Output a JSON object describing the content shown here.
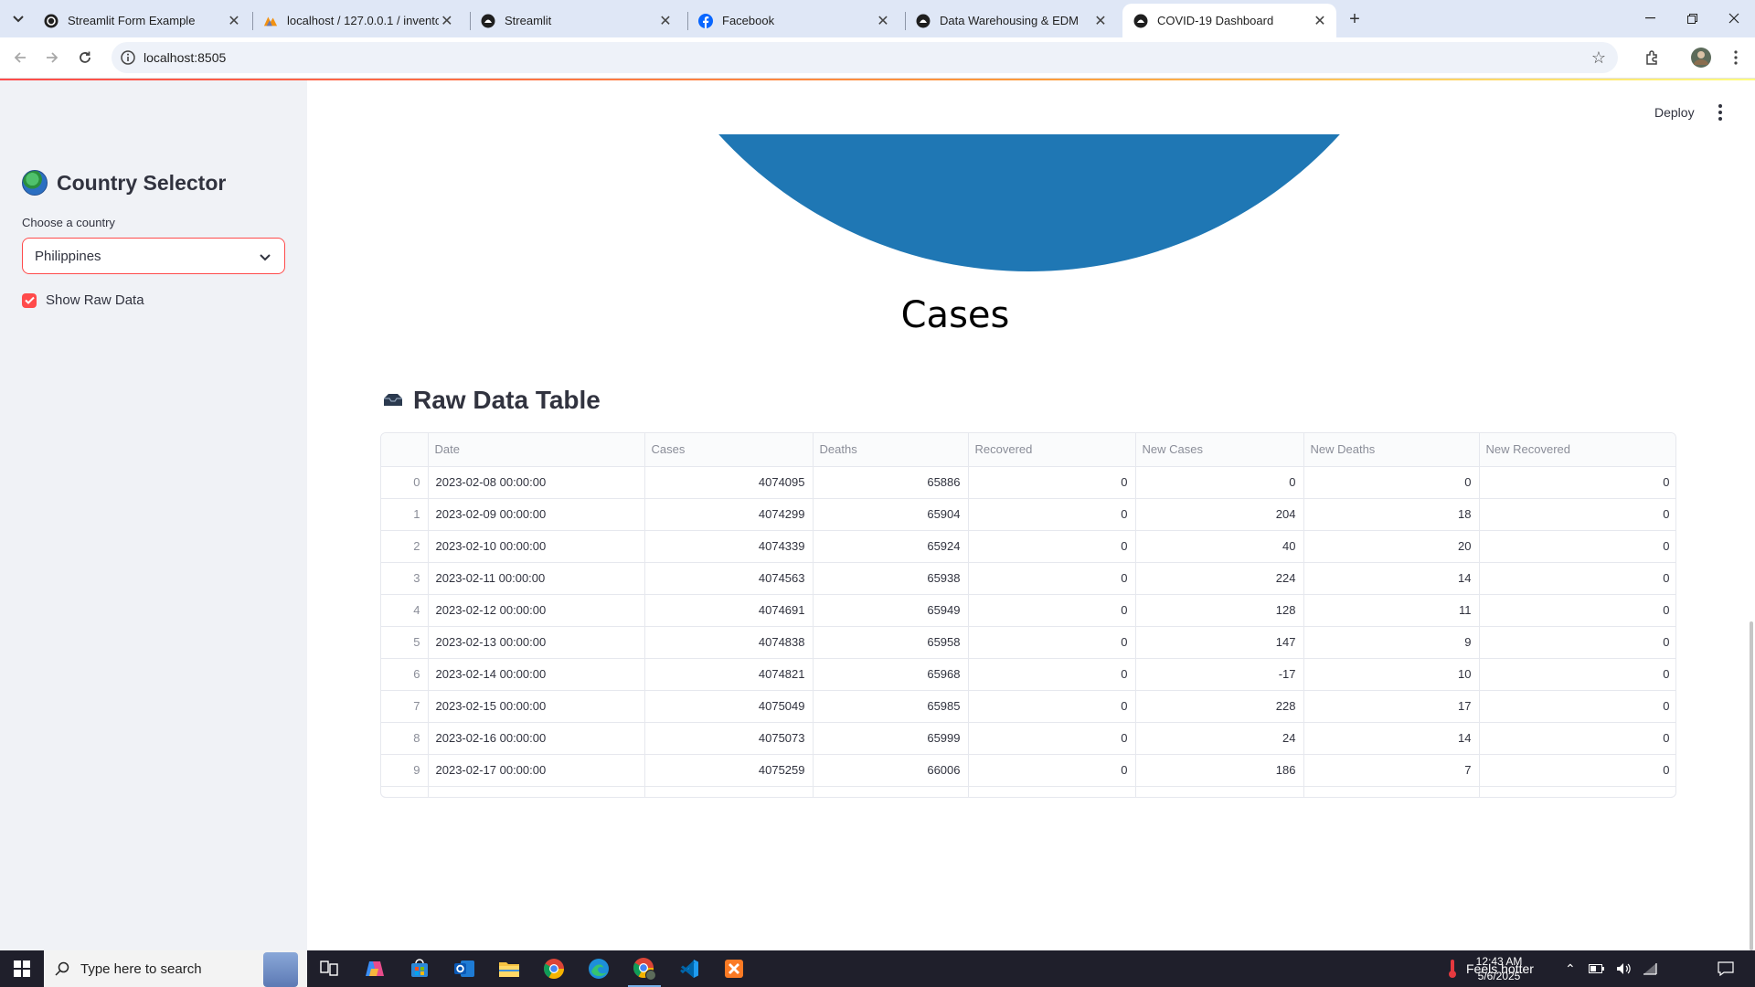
{
  "browser": {
    "tabs": [
      {
        "title": "Streamlit Form Example",
        "icon": "github-icon",
        "active": false
      },
      {
        "title": "localhost / 127.0.0.1 / inventory",
        "icon": "phpmyadmin-icon",
        "active": false
      },
      {
        "title": "Streamlit",
        "icon": "github-icon",
        "active": false
      },
      {
        "title": "Facebook",
        "icon": "facebook-icon",
        "active": false
      },
      {
        "title": "Data Warehousing & EDM",
        "icon": "github-icon",
        "active": false
      },
      {
        "title": "COVID-19 Dashboard",
        "icon": "github-icon",
        "active": true
      }
    ],
    "url": "localhost:8505"
  },
  "sidebar": {
    "title": "Country Selector",
    "select_label": "Choose a country",
    "selected_country": "Philippines",
    "show_raw_data_label": "Show Raw Data",
    "show_raw_data_checked": true
  },
  "header": {
    "deploy_label": "Deploy"
  },
  "pie": {
    "title": "Cases",
    "slice_color": "#1f77b4"
  },
  "raw_table": {
    "title": "Raw Data Table",
    "columns": [
      "Date",
      "Cases",
      "Deaths",
      "Recovered",
      "New Cases",
      "New Deaths",
      "New Recovered"
    ],
    "rows": [
      [
        "0",
        "2023-02-08 00:00:00",
        "4074095",
        "65886",
        "0",
        "0",
        "0",
        "0"
      ],
      [
        "1",
        "2023-02-09 00:00:00",
        "4074299",
        "65904",
        "0",
        "204",
        "18",
        "0"
      ],
      [
        "2",
        "2023-02-10 00:00:00",
        "4074339",
        "65924",
        "0",
        "40",
        "20",
        "0"
      ],
      [
        "3",
        "2023-02-11 00:00:00",
        "4074563",
        "65938",
        "0",
        "224",
        "14",
        "0"
      ],
      [
        "4",
        "2023-02-12 00:00:00",
        "4074691",
        "65949",
        "0",
        "128",
        "11",
        "0"
      ],
      [
        "5",
        "2023-02-13 00:00:00",
        "4074838",
        "65958",
        "0",
        "147",
        "9",
        "0"
      ],
      [
        "6",
        "2023-02-14 00:00:00",
        "4074821",
        "65968",
        "0",
        "-17",
        "10",
        "0"
      ],
      [
        "7",
        "2023-02-15 00:00:00",
        "4075049",
        "65985",
        "0",
        "228",
        "17",
        "0"
      ],
      [
        "8",
        "2023-02-16 00:00:00",
        "4075073",
        "65999",
        "0",
        "24",
        "14",
        "0"
      ],
      [
        "9",
        "2023-02-17 00:00:00",
        "4075259",
        "66006",
        "0",
        "186",
        "7",
        "0"
      ]
    ]
  },
  "taskbar": {
    "search_placeholder": "Type here to search",
    "weather": "Feels hotter",
    "time": "12:43 AM",
    "date": "5/6/2025",
    "apps": [
      "task-view-icon",
      "copilot-icon",
      "store-icon",
      "outlook-icon",
      "file-explorer-icon",
      "chrome-icon",
      "edge-icon",
      "chrome-profile-icon",
      "vscode-icon",
      "xampp-icon"
    ]
  },
  "colors": {
    "accent": "#ff4b4b",
    "sidebar_bg": "#f0f2f6",
    "text": "#31333f"
  }
}
